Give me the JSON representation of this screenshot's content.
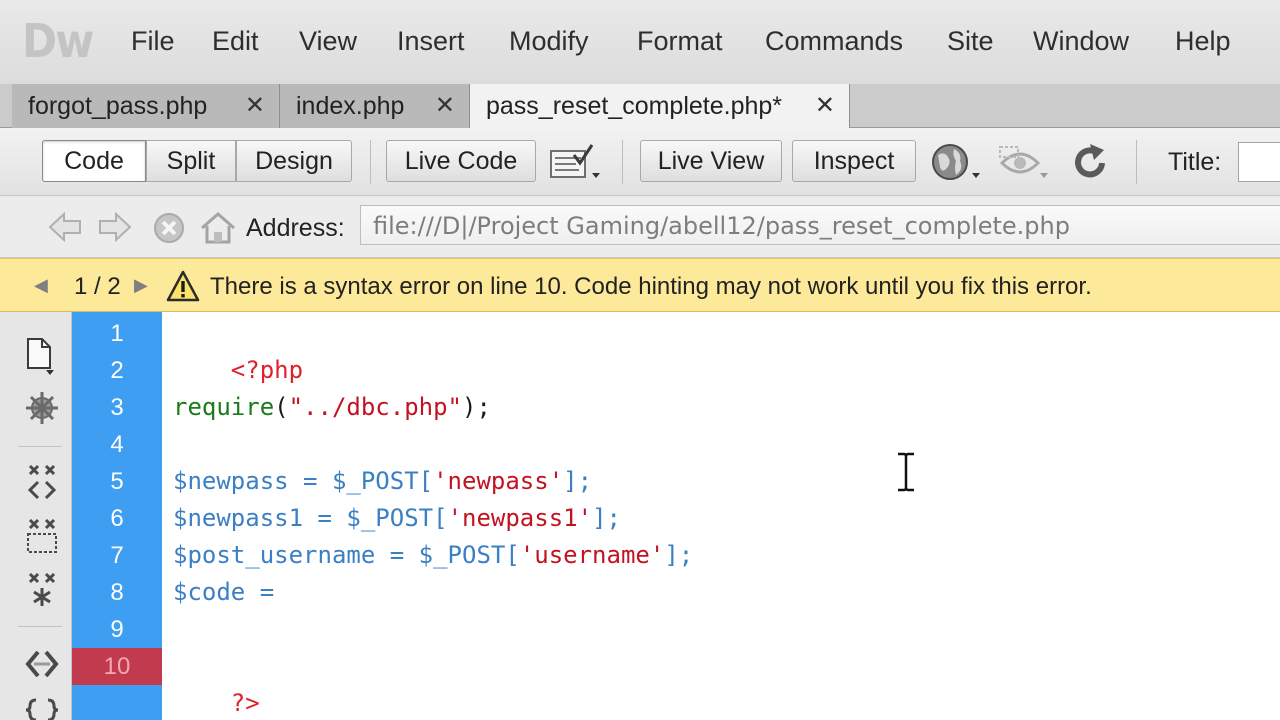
{
  "app": {
    "logo": "Dw"
  },
  "menu": [
    "File",
    "Edit",
    "View",
    "Insert",
    "Modify",
    "Format",
    "Commands",
    "Site",
    "Window",
    "Help"
  ],
  "tabs": [
    {
      "label": "forgot_pass.php",
      "close": "✕",
      "active": false
    },
    {
      "label": "index.php",
      "close": "✕",
      "active": false
    },
    {
      "label": "pass_reset_complete.php*",
      "close": "✕",
      "active": true
    }
  ],
  "toolbar": {
    "code": "Code",
    "split": "Split",
    "design": "Design",
    "live_code": "Live Code",
    "live_view": "Live View",
    "inspect": "Inspect",
    "title_label": "Title:",
    "title_value": ""
  },
  "address": {
    "label": "Address:",
    "value": "file:///D|/Project Gaming/abell12/pass_reset_complete.php"
  },
  "infobar": {
    "prev": "◀",
    "count": "1 / 2",
    "next": "▶",
    "message": "There is a syntax error on line 10.  Code hinting may not work until you fix this error."
  },
  "icons": {
    "coding_toolbar": [
      "open-documents-icon",
      "collapse-full-tag-icon",
      "collapse-selection-icon",
      "expand-all-icon",
      "select-parent-tag-icon",
      "balance-braces-icon",
      "apply-comment-icon"
    ],
    "toolbar": [
      "file-management-icon",
      "preview-in-browser-icon",
      "visual-aids-icon",
      "refresh-icon"
    ],
    "nav": [
      "back-icon",
      "forward-icon",
      "stop-icon",
      "home-icon"
    ]
  },
  "colors": {
    "gutter": "#3d9ef2",
    "error_line": "#c23a4e",
    "info_bar": "#fde99a",
    "php_tag": "#e0202a",
    "function": "#1b7a1b",
    "string": "#c21322",
    "variable": "#3b7fc4"
  },
  "code": {
    "line_numbers": [
      "1",
      "2",
      "3",
      "4",
      "5",
      "6",
      "7",
      "8",
      "9",
      "10"
    ],
    "error_line": "10",
    "lines": [
      {
        "no": "1",
        "t": {
          "open": "<?php"
        }
      },
      {
        "no": "2"
      },
      {
        "no": "3",
        "t": {
          "func": "require",
          "p1": "(",
          "s": "\"../dbc.php\"",
          "p2": ");"
        }
      },
      {
        "no": "4"
      },
      {
        "no": "5",
        "t": {
          "v": "$newpass",
          "eq": " = ",
          "v2": "$_POST",
          "b1": "[",
          "s": "'newpass'",
          "b2": "];"
        }
      },
      {
        "no": "6",
        "t": {
          "v": "$newpass1",
          "eq": " = ",
          "v2": "$_POST",
          "b1": "[",
          "s": "'newpass1'",
          "b2": "];"
        }
      },
      {
        "no": "7",
        "t": {
          "v": "$post_username",
          "eq": " = ",
          "v2": "$_POST",
          "b1": "[",
          "s": "'username'",
          "b2": "];"
        }
      },
      {
        "no": "8",
        "t": {
          "v": "$code",
          "eq": " ="
        }
      },
      {
        "no": "9"
      },
      {
        "no": "10",
        "t": {
          "close": "?>"
        }
      }
    ]
  }
}
